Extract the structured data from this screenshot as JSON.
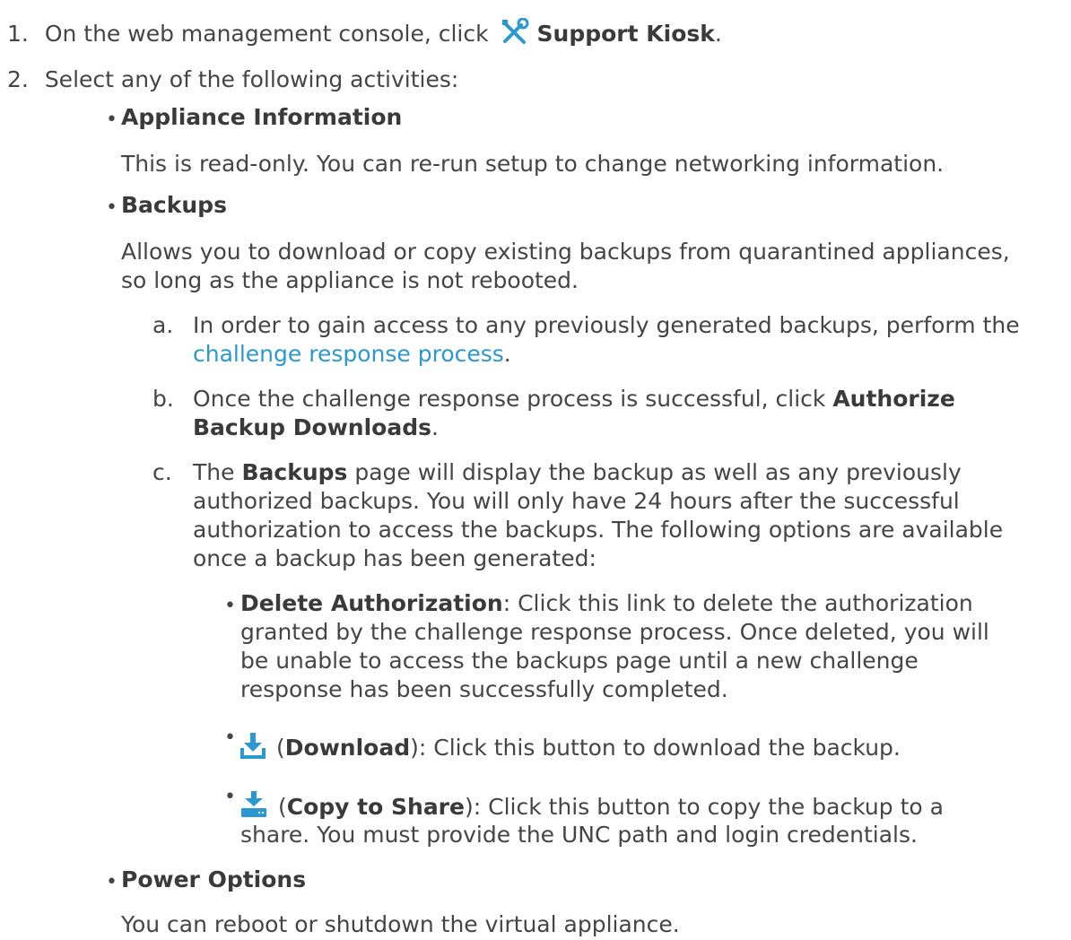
{
  "steps": [
    {
      "number": "1.",
      "text_before": "On the web management console, click",
      "icon": "support-kiosk-tools-icon",
      "bold": "Support Kiosk",
      "text_after": "."
    },
    {
      "number": "2.",
      "text": "Select any of the following activities:"
    }
  ],
  "activities": {
    "appliance_info": {
      "bullet": "•",
      "title": "Appliance Information",
      "desc": "This is read-only. You can re-run setup to change networking information."
    },
    "backups": {
      "bullet": "•",
      "title": "Backups",
      "desc_line1": "Allows you to download or copy existing backups from quarantined appliances,",
      "desc_line2": "so long as the appliance is not rebooted.",
      "substeps": {
        "a": {
          "letter": "a.",
          "line1": "In order to gain access to any previously generated backups, perform the",
          "link": "challenge response process",
          "end": "."
        },
        "b": {
          "letter": "b.",
          "line1_text": "Once the challenge response process is successful, click",
          "bold1": "Authorize",
          "bold2": "Backup Downloads",
          "end": "."
        },
        "c": {
          "letter": "c.",
          "pre": "The",
          "bold": "Backups",
          "line1_rest": "page will display the backup as well as any previously",
          "line2": "authorized backups. You will only have 24 hours after the successful",
          "line3": "authorization to access the backups. The following options are available",
          "line4": "once a backup has been generated:"
        }
      },
      "options": {
        "delete": {
          "bullet": "•",
          "bold": "Delete Authorization",
          "line1_rest": ": Click this link to delete the authorization",
          "line2": "granted by the challenge response process. Once deleted, you will",
          "line3": "be unable to access the backups page until a new challenge",
          "line4": "response has been successfully completed."
        },
        "download": {
          "bullet": "•",
          "icon": "download-icon",
          "open": "(",
          "bold": "Download",
          "rest": "): Click this button to download the backup."
        },
        "copy": {
          "bullet": "•",
          "icon": "copy-to-share-icon",
          "open": "(",
          "bold": "Copy to Share",
          "rest": "): Click this button to copy the backup to a",
          "line2": "share. You must provide the UNC path and login credentials."
        }
      }
    },
    "power": {
      "bullet": "•",
      "title": "Power Options",
      "desc": "You can reboot or shutdown the virtual appliance."
    }
  },
  "colors": {
    "text": "#454545",
    "link": "#2b98d0",
    "icon": "#2b98d0"
  }
}
